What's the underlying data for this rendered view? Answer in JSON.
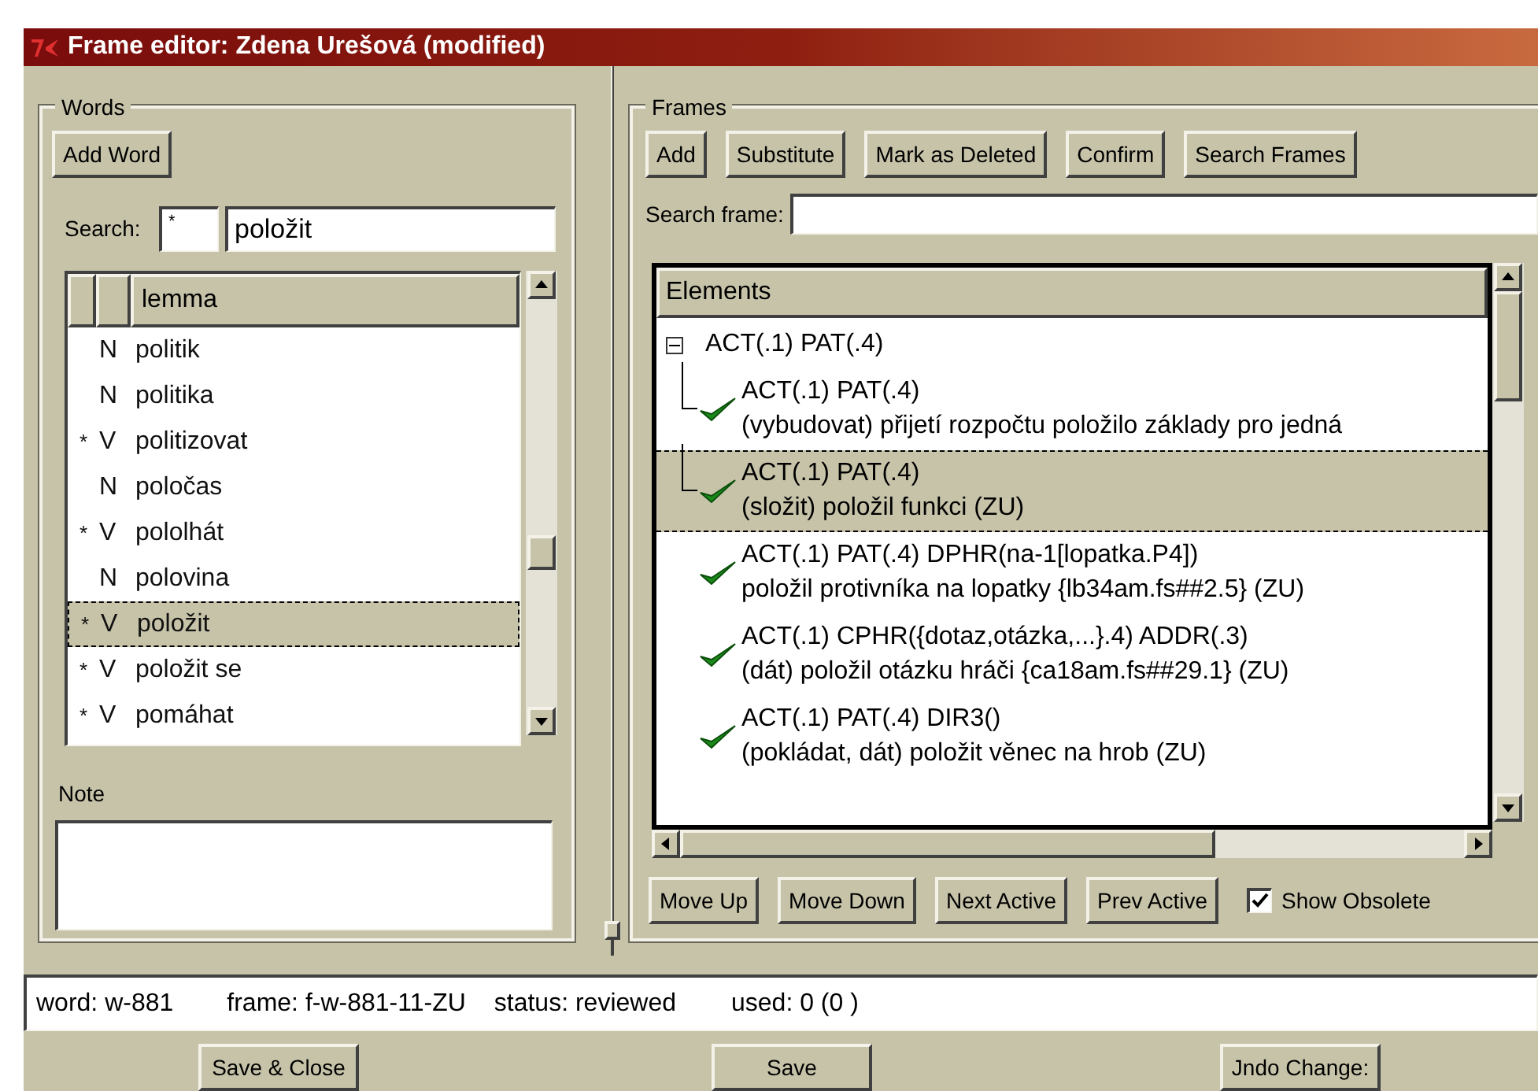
{
  "window": {
    "title": "Frame editor: Zdena Urešová (modified)"
  },
  "words": {
    "title": "Words",
    "add_button": "Add Word",
    "search_label": "Search:",
    "search_prefix": "*",
    "search_value": "položit",
    "column": "lemma",
    "rows": [
      {
        "pos": "N",
        "lemma": "politik",
        "selected": false
      },
      {
        "pos": "N",
        "lemma": "politika",
        "selected": false
      },
      {
        "mark": "*",
        "pos": "V",
        "lemma": "politizovat",
        "selected": false
      },
      {
        "pos": "N",
        "lemma": "poločas",
        "selected": false
      },
      {
        "mark": "*",
        "pos": "V",
        "lemma": "pololhát",
        "selected": false
      },
      {
        "pos": "N",
        "lemma": "polovina",
        "selected": false
      },
      {
        "mark": "*",
        "pos": "V",
        "lemma": "položit",
        "selected": true
      },
      {
        "mark": "*",
        "pos": "V",
        "lemma": "položit se",
        "selected": false
      },
      {
        "mark": "*",
        "pos": "V",
        "lemma": "pomáhat",
        "selected": false
      }
    ],
    "note_label": "Note"
  },
  "frames": {
    "title": "Frames",
    "buttons": [
      "Add",
      "Substitute",
      "Mark as Deleted",
      "Confirm",
      "Search Frames"
    ],
    "search_label": "Search frame:",
    "column": "Elements",
    "items": [
      {
        "line1": "ACT(.1) PAT(.4)",
        "expanded": true,
        "selected": false,
        "children": [
          {
            "line1": "ACT(.1)  PAT(.4)",
            "line2": "(vybudovat) přijetí rozpočtu položilo základy pro jedná",
            "confirmed": true,
            "selected": false
          },
          {
            "line1": "ACT(.1)  PAT(.4)",
            "line2": "(složit) položil funkci (ZU)",
            "confirmed": true,
            "selected": true
          }
        ]
      },
      {
        "line1": "ACT(.1)  PAT(.4)  DPHR(na-1[lopatka.P4])",
        "line2": "položil protivníka na lopatky  {lb34am.fs##2.5} (ZU)",
        "confirmed": true,
        "selected": false
      },
      {
        "line1": "ACT(.1)  CPHR({dotaz,otázka,...}.4)  ADDR(.3)",
        "line2": "(dát) položil otázku hráči  {ca18am.fs##29.1} (ZU)",
        "confirmed": true,
        "selected": false
      },
      {
        "line1": "ACT(.1)  PAT(.4)  DIR3()",
        "line2": "(pokládat, dát) položit věnec na hrob (ZU)",
        "confirmed": true,
        "selected": false
      }
    ],
    "bottom_buttons": [
      "Move Up",
      "Move Down",
      "Next Active",
      "Prev Active"
    ],
    "show_obsolete": {
      "label": "Show Obsolete",
      "checked": true
    }
  },
  "status": [
    "word: w-881",
    "frame: f-w-881-11-ZU",
    "status: reviewed",
    "used: 0 (0 )"
  ],
  "buttons": [
    "Save & Close",
    "Save",
    "Jndo Change:"
  ]
}
